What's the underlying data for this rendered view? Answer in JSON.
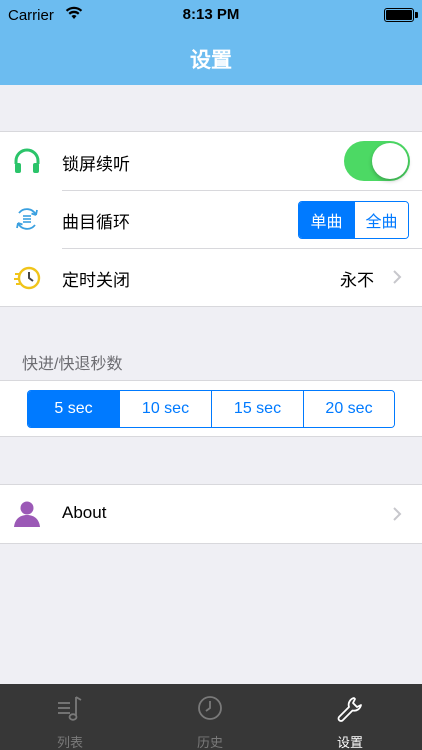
{
  "status_bar": {
    "carrier": "Carrier",
    "time": "8:13 PM"
  },
  "nav": {
    "title": "设置"
  },
  "settings": {
    "lock_screen": {
      "label": "锁屏续听",
      "icon": "headphones-icon",
      "enabled": true
    },
    "loop": {
      "label": "曲目循环",
      "icon": "repeat-list-icon",
      "options": [
        "单曲",
        "全曲"
      ],
      "selected": "单曲"
    },
    "timer": {
      "label": "定时关闭",
      "icon": "timer-icon",
      "value": "永不"
    }
  },
  "seek": {
    "label": "快进/快退秒数",
    "options": [
      "5 sec",
      "10 sec",
      "15 sec",
      "20 sec"
    ],
    "selected": "5 sec"
  },
  "about": {
    "label": "About",
    "icon": "user-icon"
  },
  "tabbar": {
    "tabs": [
      {
        "label": "列表",
        "icon": "music-list-icon",
        "active": false
      },
      {
        "label": "历史",
        "icon": "clock-icon",
        "active": false
      },
      {
        "label": "设置",
        "icon": "wrench-icon",
        "active": true
      }
    ]
  },
  "colors": {
    "header": "#6cbcf0",
    "accent": "#007aff",
    "toggle_on": "#4cd964",
    "headphones": "#2bc46a",
    "timer": "#f0c419",
    "user": "#9b59b6",
    "tabbar": "#373737"
  }
}
